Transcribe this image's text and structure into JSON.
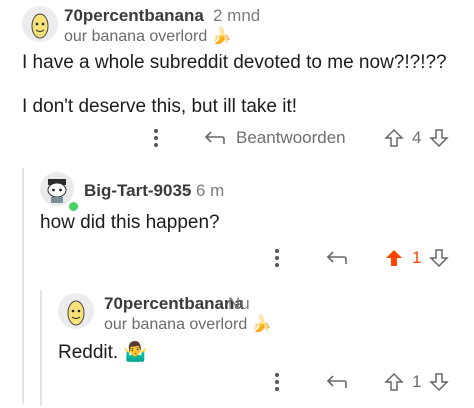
{
  "comments": [
    {
      "username": "70percentbanana",
      "timestamp": "2 mnd",
      "flair": "our banana overlord",
      "flair_emoji": "🍌",
      "body": [
        "I have a whole subreddit devoted to me now?!?!??",
        "I don't deserve this, but ill take it!"
      ],
      "actions": {
        "reply_label": "Beantwoorden",
        "vote_count": "4",
        "upvoted": false
      }
    },
    {
      "username": "Big-Tart-9035",
      "separator": "·",
      "timestamp": "6 m",
      "online": true,
      "body": [
        "how did this happen?"
      ],
      "actions": {
        "vote_count": "1",
        "upvoted": true
      }
    },
    {
      "username": "70percentbanana",
      "timestamp": "Nu",
      "flair": "our banana overlord",
      "flair_emoji": "🍌",
      "body": [
        "Reddit."
      ],
      "body_emoji": "🤷‍♂️",
      "actions": {
        "vote_count": "1",
        "upvoted": false
      }
    }
  ],
  "colors": {
    "upvote_active": "#ff4500",
    "text_muted": "#6e6e6e",
    "thread_line": "#e3e3e3"
  }
}
